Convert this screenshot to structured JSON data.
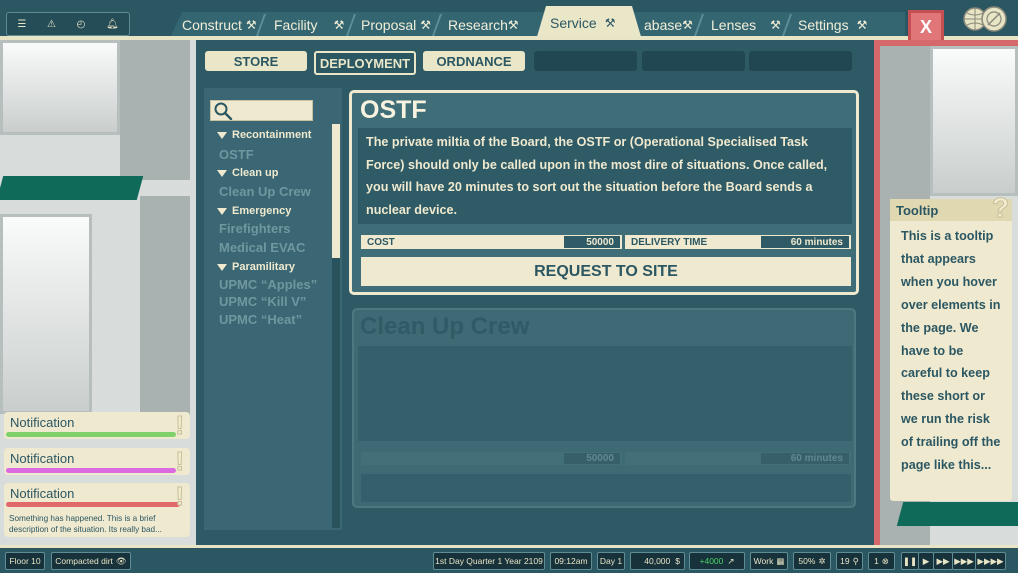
{
  "top": {
    "quick_icons": [
      "list-icon",
      "warning-icon",
      "clock-icon",
      "bell-icon"
    ],
    "tabs": [
      {
        "label": "Construct",
        "icon": "⚒"
      },
      {
        "label": "Facility",
        "icon": "⚒"
      },
      {
        "label": "Proposal",
        "icon": "⚒"
      },
      {
        "label": "Research",
        "icon": "⚒"
      },
      {
        "label": "Service",
        "icon": "⚒"
      },
      {
        "label": "abase",
        "icon": "⚒"
      },
      {
        "label": "Lenses",
        "icon": "⚒"
      },
      {
        "label": "Settings",
        "icon": "⚒"
      }
    ],
    "active_tab": "Service",
    "close_label": "X"
  },
  "subtabs": [
    "STORE",
    "DEPLOYMENT",
    "ORDNANCE"
  ],
  "active_subtab": "DEPLOYMENT",
  "list": {
    "groups": [
      {
        "name": "Recontainment",
        "items": [
          "OSTF"
        ]
      },
      {
        "name": "Clean up",
        "items": [
          "Clean Up Crew"
        ]
      },
      {
        "name": "Emergency",
        "items": [
          "Firefighters",
          "Medical EVAC"
        ]
      },
      {
        "name": "Paramilitary",
        "items": [
          "UPMC “Apples”",
          "UPMC “Kill V”",
          "UPMC “Heat”"
        ]
      }
    ]
  },
  "card": {
    "title": "OSTF",
    "description": "The private miltia of the Board, the OSTF or (Operational Specialised Task Force) should only be called upon in the most dire of situations. Once called, you will have 20 minutes to sort out the situation before the Board sends a nuclear device.",
    "cost_label": "COST",
    "cost_value": "50000",
    "delivery_label": "DELIVERY TIME",
    "delivery_value": "60 minutes",
    "request_label": "REQUEST TO SITE"
  },
  "card2": {
    "title": "Clean Up Crew",
    "cost_value": "50000",
    "delivery_value": "60 minutes"
  },
  "tooltip": {
    "title": "Tooltip",
    "mark": "?",
    "body": "This is a tooltip that appears when you hover over elements in the page. We have to be careful to keep these short or we run the risk of trailing off the page like this..."
  },
  "notifications": [
    {
      "title": "Notification",
      "color": "#7ed06a",
      "mark": "!"
    },
    {
      "title": "Notification",
      "color": "#d96adf",
      "mark": "!"
    },
    {
      "title": "Notification",
      "color": "#e0686a",
      "mark": "!",
      "text": "Something has happened.  This is a brief description of the situation. Its really bad..."
    }
  ],
  "status": {
    "floor": "Floor 10",
    "terrain": "Compacted dirt",
    "date": "1st Day Quarter 1 Year 2109",
    "time": "09:12am",
    "day": "Day 1",
    "money": "40,000",
    "income": "+4000",
    "work": "Work",
    "percent": "50%",
    "count1": "19",
    "count2": "1",
    "speed_controls": [
      "❚❚",
      "▶",
      "▶▶",
      "▶▶▶",
      "▶▶▶▶"
    ]
  }
}
